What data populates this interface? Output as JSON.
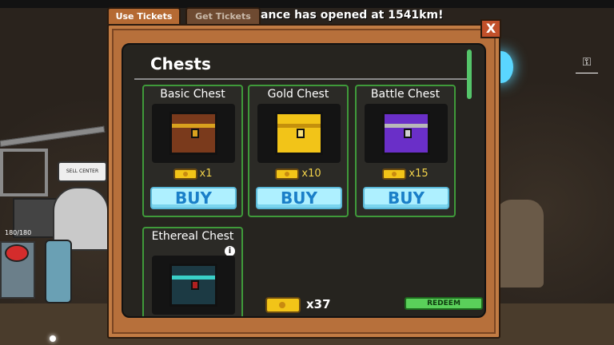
{
  "tabs": {
    "use_tickets": "Use Tickets",
    "get_tickets": "Get Tickets"
  },
  "announcement": "ance has opened at 1541km!",
  "close_label": "X",
  "panel": {
    "title": "Chests"
  },
  "chests": [
    {
      "name": "Basic Chest",
      "price": "x1",
      "buy_label": "BUY",
      "color": "#7a3a1c"
    },
    {
      "name": "Gold Chest",
      "price": "x10",
      "buy_label": "BUY",
      "color": "#f2c418"
    },
    {
      "name": "Battle Chest",
      "price": "x15",
      "buy_label": "BUY",
      "color": "#6a2fc8"
    },
    {
      "name": "Ethereal Chest",
      "info_icon": "i",
      "color": "#1c3a44"
    }
  ],
  "footer": {
    "ticket_balance": "x37",
    "redeem_label": "REDEEM"
  },
  "background": {
    "sell_center_sign": "SELL CENTER",
    "hp_readout": "180/180",
    "key_icon": "key-icon"
  },
  "colors": {
    "frame": "#b7703b",
    "panel": "#26241f",
    "card_border": "#3f9a3a",
    "buy_button": "#aef0ff",
    "redeem_button": "#5ad05a"
  }
}
